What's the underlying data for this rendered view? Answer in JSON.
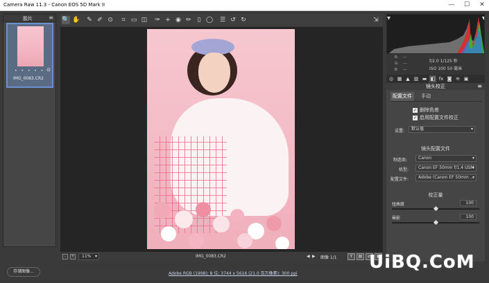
{
  "window": {
    "title": "Camera Raw 11.3 -  Canon EOS 5D Mark II",
    "minimize": "—",
    "maximize": "☐",
    "close": "✕"
  },
  "filmstrip": {
    "header": "胶片",
    "menu_icon": "≡",
    "thumbnail": {
      "filename": "IMG_0083.CR2",
      "stars": "• • • • •",
      "badge": "⊙"
    }
  },
  "toolbar": {
    "tools": [
      "zoom-icon",
      "hand-icon",
      "white-balance-icon",
      "color-sampler-icon",
      "targeted-adjust-icon",
      "crop-icon",
      "straighten-icon",
      "transform-icon",
      "spot-removal-icon",
      "red-eye-icon",
      "adjustment-brush-icon",
      "graduated-filter-icon",
      "radial-filter-icon",
      "preferences-icon",
      "rotate-ccw-icon",
      "rotate-cw-icon"
    ],
    "fullscreen_icon": "fullscreen-icon"
  },
  "preview": {
    "zoom": "11%",
    "zoom_minus": "-",
    "zoom_plus": "+",
    "filename": "IMG_0083.CR2",
    "image_label": "图像 1/1",
    "prev": "◀",
    "next": "▶",
    "view_buttons": [
      "Y",
      "▤",
      "⇄",
      "▣"
    ]
  },
  "camera_info": {
    "r_label": "R:",
    "g_label": "G:",
    "b_label": "B:",
    "r_val": "---",
    "g_val": "---",
    "b_val": "---",
    "exposure": "f/2.0   1/125 秒",
    "iso": "ISO 100   50 毫米"
  },
  "panel_tabs": [
    "basic-icon",
    "tone-curve-icon",
    "detail-icon",
    "hsl-icon",
    "split-toning-icon",
    "lens-icon",
    "effects-icon",
    "calibration-icon",
    "presets-icon",
    "snapshots-icon"
  ],
  "lens_panel": {
    "title": "镜头校正",
    "menu_icon": "≡",
    "subtabs": [
      "配置文件",
      "手动"
    ],
    "remove_ca": "删除色差",
    "enable_profile": "启用配置文件校正",
    "setup_label": "设置:",
    "setup_value": "默认值",
    "lens_profile_title": "镜头配置文件",
    "make_label": "制造商:",
    "make_value": "Canon",
    "model_label": "机型:",
    "model_value": "Canon EF 50mm f/1.4 USM",
    "profile_label": "配置文件:",
    "profile_value": "Adobe (Canon EF 50mm ...",
    "amount_title": "校正量",
    "distortion_label": "扭曲度",
    "distortion_value": "100",
    "vignette_label": "晕影",
    "vignette_value": "100",
    "distortion_level": 0.5,
    "vignette_level": 0.5
  },
  "bottom": {
    "save_label": "存储图像...",
    "workflow": "Adobe RGB (1998); 8 位; 3744 x 5616 (21.0 百万像素); 300 ppi"
  },
  "watermark": "UiBQ.CoM"
}
